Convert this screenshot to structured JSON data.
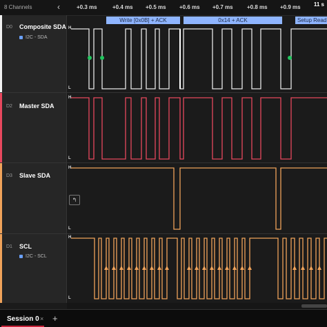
{
  "header": {
    "channels_label": "8 Channels",
    "collapse_icon": "chevron-left-icon",
    "corner_label": "11 s",
    "time_ticks": [
      "+0.3 ms",
      "+0.4 ms",
      "+0.5 ms",
      "+0.6 ms",
      "+0.7 ms",
      "+0.8 ms",
      "+0.9 ms"
    ]
  },
  "annotations": [
    "Write [0x0B] + ACK",
    "0x14 + ACK",
    "Setup Read"
  ],
  "channels": [
    {
      "id": "D0",
      "name": "Composite SDA",
      "analyzer": "I2C - SDA",
      "color": "#e8e8e8"
    },
    {
      "id": "D2",
      "name": "Master SDA",
      "analyzer": "",
      "color": "#e8485e"
    },
    {
      "id": "D3",
      "name": "Slave SDA",
      "analyzer": "",
      "color": "#f0a35a"
    },
    {
      "id": "D1",
      "name": "SCL",
      "analyzer": "I2C - SCL",
      "color": "#f0a35a"
    }
  ],
  "levels": {
    "high": "H",
    "low": "L"
  },
  "tooltip_icon": "arrow-icon",
  "footer": {
    "session_label": "Session 0",
    "close_icon": "close-icon",
    "add_label": "+"
  }
}
